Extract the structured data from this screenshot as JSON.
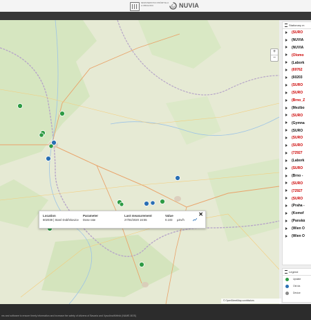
{
  "header": {
    "gov_logo_text": "MINISTERSTVO PRŮMYSLU A OBCHODU",
    "brand": "NUVIA"
  },
  "panel": {
    "title": "Stationary m",
    "items": [
      {
        "label": "(SURO",
        "red": true
      },
      {
        "label": "(NUVIA",
        "red": false
      },
      {
        "label": "(NUVIA",
        "red": false
      },
      {
        "label": "(Olomo",
        "red": true
      },
      {
        "label": "(Labork",
        "red": false
      },
      {
        "label": "(69762",
        "red": true
      },
      {
        "label": "(60203",
        "red": false
      },
      {
        "label": "(SURO",
        "red": true
      },
      {
        "label": "(SURO",
        "red": true
      },
      {
        "label": "(Brno_Z",
        "red": true
      },
      {
        "label": "(Mezibo",
        "red": false
      },
      {
        "label": "(SURO",
        "red": true
      },
      {
        "label": "(Gymna",
        "red": false
      },
      {
        "label": "(SURO",
        "red": false
      },
      {
        "label": "(SURO",
        "red": true
      },
      {
        "label": "(SURO",
        "red": true
      },
      {
        "label": "(72927",
        "red": true
      },
      {
        "label": "(Labork",
        "red": false
      },
      {
        "label": "(SURO",
        "red": true
      },
      {
        "label": "(Brno -",
        "red": false
      },
      {
        "label": "(SURO",
        "red": true
      },
      {
        "label": "(72927",
        "red": true
      },
      {
        "label": "(SURO",
        "red": true
      },
      {
        "label": "(Praha -",
        "red": false
      },
      {
        "label": "(Komof",
        "red": false
      },
      {
        "label": "(Panská",
        "red": false
      },
      {
        "label": "(Wien O",
        "red": false
      },
      {
        "label": "(Wien O",
        "red": false
      }
    ]
  },
  "legend": {
    "title": "Legend",
    "items": [
      {
        "label": "Update",
        "color": "#2e9b44"
      },
      {
        "label": "Old da",
        "color": "#2a6fb3"
      },
      {
        "label": "Device",
        "color": "#8a8a8a"
      }
    ]
  },
  "popup": {
    "location_header": "Location",
    "location_value": "602038 | Staré Dobřekovice",
    "parameter_header": "Parameter",
    "parameter_value": "Dose rate",
    "last_header": "Last measurement",
    "last_value": "27/04/2020 16:55",
    "value_header": "Value",
    "value_num": "0.103",
    "value_unit": "µSv/h",
    "close": "✕"
  },
  "map": {
    "zoom_in": "+",
    "zoom_out": "−",
    "attribution": "© OpenStreetMap contributors"
  },
  "markers": [
    {
      "color": "#2e9b44"
    },
    {
      "color": "#2e9b44"
    },
    {
      "color": "#2e9b44"
    },
    {
      "color": "#2e9b44"
    },
    {
      "color": "#2a6fb3"
    },
    {
      "color": "#2e9b44"
    },
    {
      "color": "#2a6fb3"
    },
    {
      "color": "#2a6fb3"
    },
    {
      "color": "#2e9b44"
    },
    {
      "color": "#2a6fb3"
    },
    {
      "color": "#2a6fb3"
    },
    {
      "color": "#2e9b44"
    },
    {
      "color": "#2e9b44"
    },
    {
      "color": "#2e9b44"
    },
    {
      "color": "#2e9b44"
    }
  ],
  "footer": {
    "text": "ms and software to ensure timely information and increase the safety of citizens of Bavaria and Vysočina/Mělník (NAME-BOS)"
  }
}
